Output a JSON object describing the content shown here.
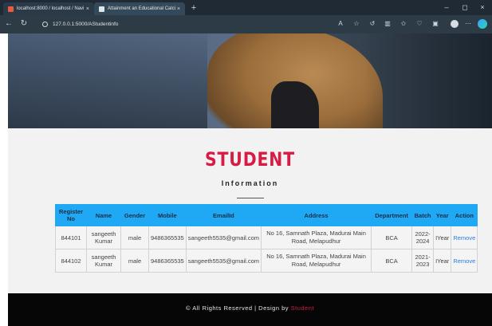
{
  "browser": {
    "tabs": [
      {
        "label": "localhost:8000 / localhost / Navi",
        "close": "×"
      },
      {
        "label": "Attainment an Educational Calci",
        "close": "×"
      }
    ],
    "new_tab": "+",
    "url": "127.0.0.1:5000/AStudentinfo",
    "window_controls": {
      "minimize": "–",
      "restore": "◻",
      "close": "×"
    },
    "icons": [
      "back-icon",
      "refresh-icon",
      "info-icon",
      "read-aloud-icon",
      "favorite-icon",
      "refresh-tab-icon",
      "split-screen-icon",
      "favorites-icon",
      "browser-essentials-icon",
      "collections-icon",
      "profile-icon",
      "more-icon",
      "edge-copilot-icon"
    ]
  },
  "page": {
    "title": "STUDENT",
    "subtitle": "Information",
    "accent_color": "#d61b45",
    "header_color": "#1fa9f5"
  },
  "table": {
    "headers": [
      "Register No",
      "Name",
      "Gender",
      "Mobile",
      "EmailId",
      "Address",
      "Department",
      "Batch",
      "Year",
      "Action"
    ],
    "rows": [
      {
        "register_no": "844101",
        "name": "sangeeth Kumar",
        "gender": "male",
        "mobile": "9486365535",
        "email": "sangeeth5535@gmail.com",
        "address": "No 16, Samnath Plaza, Madurai Main Road, Melapudhur",
        "department": "BCA",
        "batch": "2022-2024",
        "year": "IYear",
        "action": "Remove"
      },
      {
        "register_no": "844102",
        "name": "sangeeth Kumar",
        "gender": "male",
        "mobile": "9486365535",
        "email": "sangeeth5535@gmail.com",
        "address": "No 16, Samnath Plaza, Madurai Main Road, Melapudhur",
        "department": "BCA",
        "batch": "2021-2023",
        "year": "IYear",
        "action": "Remove"
      }
    ]
  },
  "footer": {
    "text": "© All Rights Reserved | Design by",
    "brand": "Student"
  }
}
